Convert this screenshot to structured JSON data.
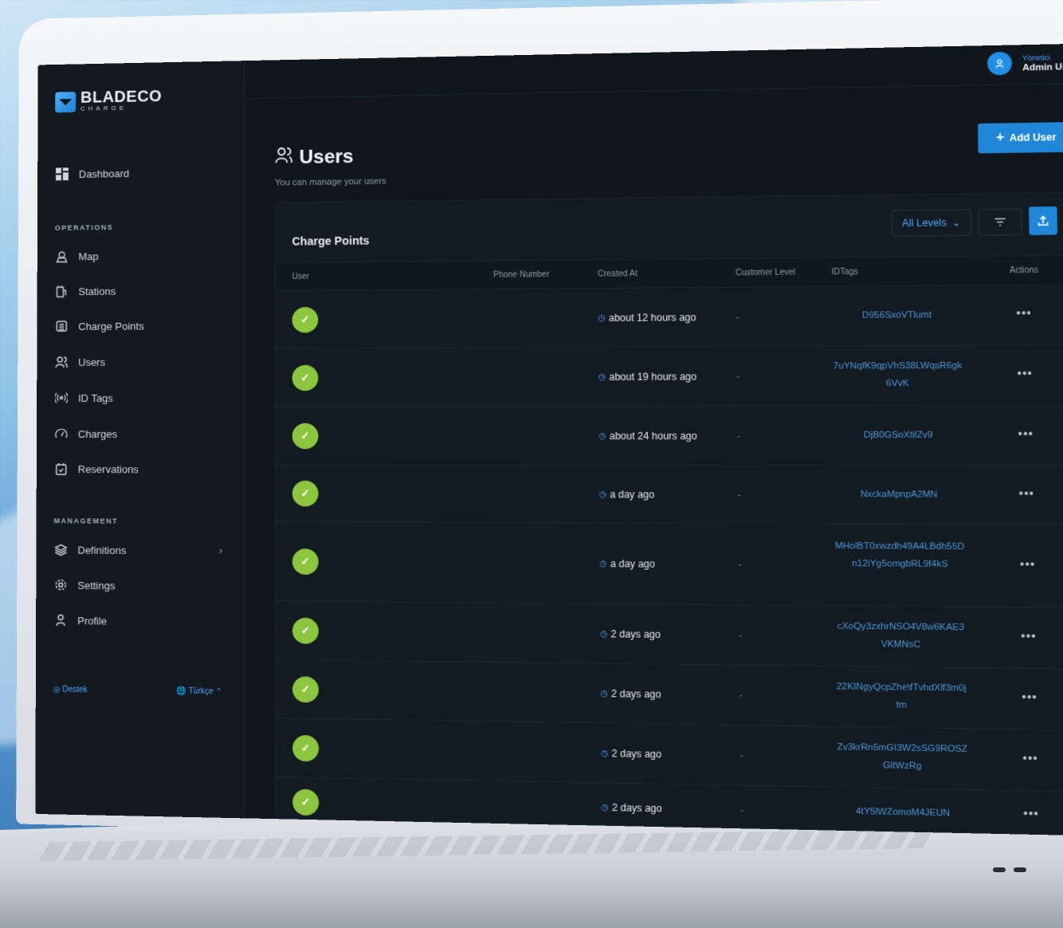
{
  "brand": {
    "name": "BLADECO",
    "sub": "CHARGE"
  },
  "sidebar": {
    "dashboard": "Dashboard",
    "operations_title": "OPERATIONS",
    "operations": [
      {
        "label": "Map",
        "icon": "map-icon"
      },
      {
        "label": "Stations",
        "icon": "station-icon"
      },
      {
        "label": "Charge Points",
        "icon": "charge-point-icon"
      },
      {
        "label": "Users",
        "icon": "users-icon"
      },
      {
        "label": "ID Tags",
        "icon": "id-tag-icon"
      },
      {
        "label": "Charges",
        "icon": "gauge-icon"
      },
      {
        "label": "Reservations",
        "icon": "calendar-icon"
      }
    ],
    "management_title": "MANAGEMENT",
    "management": [
      {
        "label": "Definitions",
        "icon": "layers-icon"
      },
      {
        "label": "Settings",
        "icon": "gear-icon"
      },
      {
        "label": "Profile",
        "icon": "person-icon"
      }
    ],
    "footer": {
      "support": "Destek",
      "language": "Türkçe"
    }
  },
  "header": {
    "role": "Yönetici",
    "user_name": "Admin User"
  },
  "page": {
    "title": "Users",
    "subtitle": "You can manage your users",
    "add_button": "Add User"
  },
  "table": {
    "title": "Charge Points",
    "filter": "All Levels",
    "columns": [
      "User",
      "Phone Number",
      "Created At",
      "Customer Level",
      "IDTags",
      "Actions"
    ],
    "rows": [
      {
        "created": "about 12 hours ago",
        "level": "-",
        "idtag": "D956SxoVTlumt"
      },
      {
        "created": "about 19 hours ago",
        "level": "-",
        "idtag": "7uYNqfK9qpVhS38LWqsR6gk6VvK"
      },
      {
        "created": "about 24 hours ago",
        "level": "-",
        "idtag": "DjB0GSoXtilZv9"
      },
      {
        "created": "a day ago",
        "level": "-",
        "idtag": "NxckaMpnpA2MN"
      },
      {
        "created": "a day ago",
        "level": "-",
        "idtag": "MHolBT0xwzdh49A4LBdh55Dn12iYg5omgbRL9f4kS"
      },
      {
        "created": "2 days ago",
        "level": "-",
        "idtag": "cXoQy3zxhrNSO4V8w6KAE3VKMNsC"
      },
      {
        "created": "2 days ago",
        "level": "-",
        "idtag": "22KINgyQcpZhe\\fTvhdXlf3m0jtm"
      },
      {
        "created": "2 days ago",
        "level": "-",
        "idtag": "Zv3krRn5mGI3W2sSG9ROSZGltWzRg"
      },
      {
        "created": "2 days ago",
        "level": "-",
        "idtag": "4tY5lWZomoM4JEUN"
      }
    ],
    "actions_label": "•••"
  }
}
